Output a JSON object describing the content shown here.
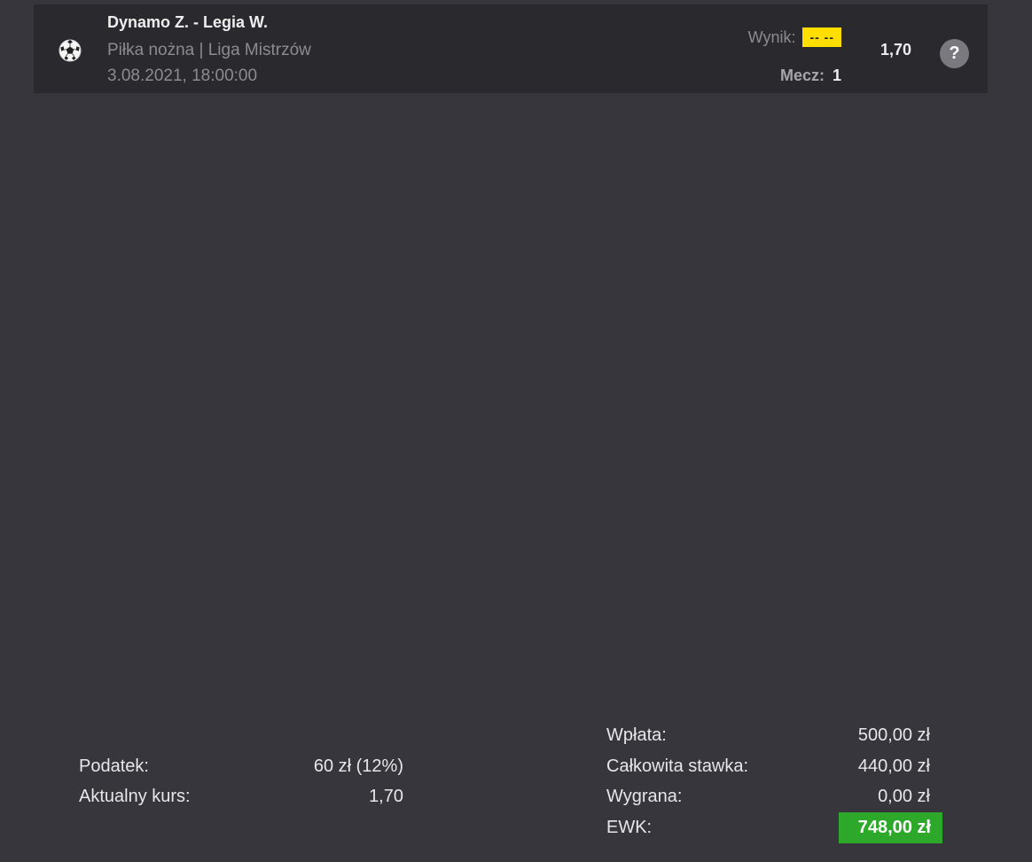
{
  "event": {
    "sport_icon": "soccer-ball-icon",
    "title": "Dynamo Z. - Legia W.",
    "league": "Piłka nożna | Liga Mistrzów",
    "date": "3.08.2021, 18:00:00",
    "result_label": "Wynik:",
    "result_value": "-- --",
    "match_label": "Mecz:",
    "match_value": "1",
    "odds": "1,70",
    "help_label": "?",
    "help_icon": "question-circle-icon"
  },
  "summary_left": {
    "tax_label": "Podatek:",
    "tax_value": "60 zł (12%)",
    "odds_label": "Aktualny kurs:",
    "odds_value": "1,70"
  },
  "summary_right": {
    "deposit_label": "Wpłata:",
    "deposit_value": "500,00 zł",
    "stake_label": "Całkowita stawka:",
    "stake_value": "440,00 zł",
    "win_label": "Wygrana:",
    "win_value": "0,00 zł",
    "ewk_label": "EWK:",
    "ewk_value": "748,00 zł"
  },
  "colors": {
    "background": "#37363c",
    "row_background": "#2a292e",
    "result_badge": "#ffde00",
    "ewk_badge": "#2ea82a"
  }
}
